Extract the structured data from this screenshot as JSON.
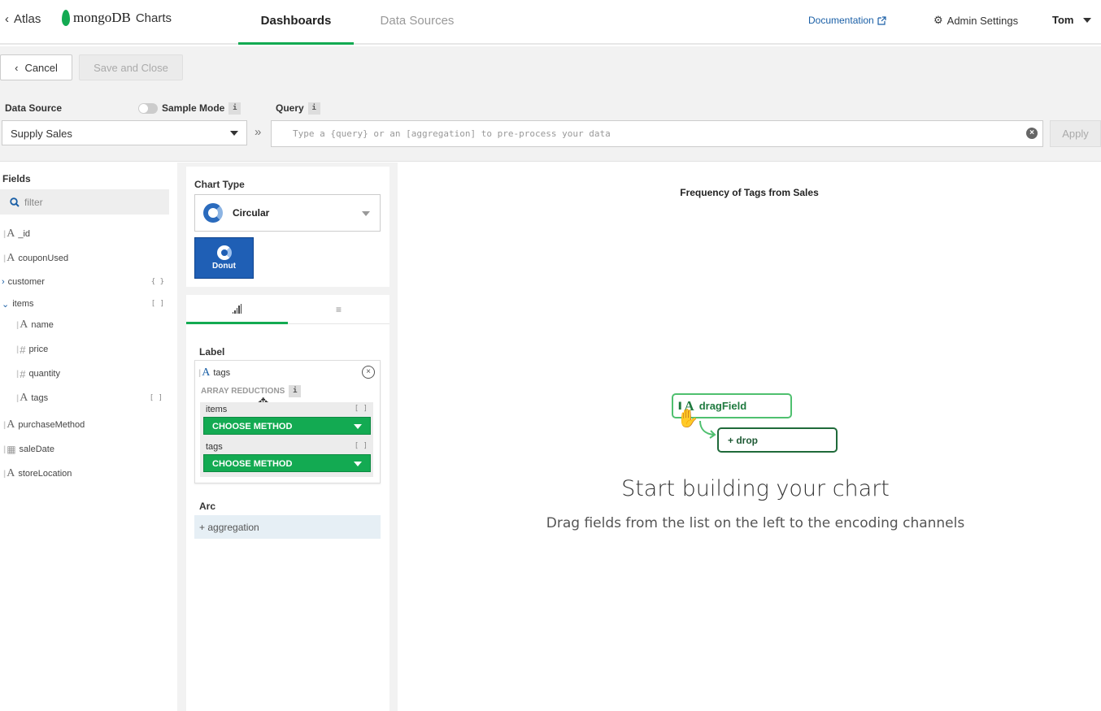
{
  "header": {
    "back_label": "Atlas",
    "logo_text": "mongoDB",
    "logo_sub": "Charts",
    "tabs": [
      {
        "label": "Dashboards",
        "active": true
      },
      {
        "label": "Data Sources",
        "active": false
      }
    ],
    "documentation": "Documentation",
    "admin_settings": "Admin Settings",
    "user": "Tom"
  },
  "toolbar": {
    "cancel_label": "Cancel",
    "save_label": "Save and Close"
  },
  "data_source": {
    "label": "Data Source",
    "value": "Supply Sales",
    "sample_mode_label": "Sample Mode",
    "info_glyph": "i"
  },
  "query": {
    "label": "Query",
    "placeholder": "Type a {query} or an [aggregation] to pre-process your data",
    "apply_label": "Apply"
  },
  "fields_panel": {
    "title": "Fields",
    "filter_placeholder": "filter",
    "items": [
      {
        "name": "_id",
        "type": "string"
      },
      {
        "name": "couponUsed",
        "type": "string"
      },
      {
        "name": "customer",
        "type": "object",
        "badge": "{ }"
      },
      {
        "name": "items",
        "type": "array",
        "badge": "[ ]"
      },
      {
        "name": "name",
        "type": "string"
      },
      {
        "name": "price",
        "type": "number"
      },
      {
        "name": "quantity",
        "type": "number"
      },
      {
        "name": "tags",
        "type": "string",
        "badge": "[ ]"
      },
      {
        "name": "purchaseMethod",
        "type": "string"
      },
      {
        "name": "saleDate",
        "type": "date"
      },
      {
        "name": "storeLocation",
        "type": "string"
      }
    ]
  },
  "chart_type": {
    "title": "Chart Type",
    "selected": "Circular",
    "variant": "Donut"
  },
  "encode": {
    "label_title": "Label",
    "label_field": "tags",
    "array_reductions_title": "ARRAY REDUCTIONS",
    "reductions": [
      {
        "name": "items",
        "badge": "[ ]",
        "method": "CHOOSE METHOD"
      },
      {
        "name": "tags",
        "badge": "[ ]",
        "method": "CHOOSE METHOD"
      }
    ],
    "arc_title": "Arc",
    "aggregation_placeholder": "+ aggregation"
  },
  "canvas": {
    "chart_title": "Frequency of Tags from Sales",
    "drag_field": "dragField",
    "drop_label": "+ drop",
    "start_title": "Start building your chart",
    "start_sub": "Drag fields from the list on the left to the encoding channels"
  },
  "colors": {
    "accent_green": "#13aa52",
    "link_blue": "#1a5fa6",
    "donut_blue": "#1f5fb5"
  }
}
